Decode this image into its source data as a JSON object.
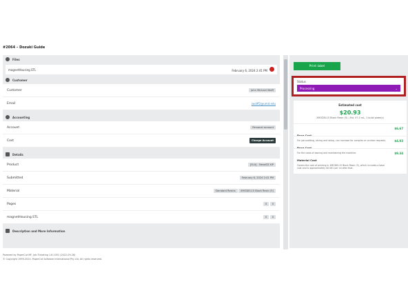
{
  "title": "#2064 – Dozuki Guide",
  "files": {
    "header": "Files",
    "name": "magnetHousing.STL",
    "date": "February 6, 2024 2:41 PM"
  },
  "customer": {
    "header": "Customer",
    "label": "Customer",
    "name": "John Michael Wolff",
    "email_label": "Email",
    "email": "jwolff2@umd.edu"
  },
  "accounting": {
    "header": "Accounting",
    "account_label": "Account",
    "account": "Personal account",
    "cost_label": "Cost",
    "charge": "Charge Account"
  },
  "details": {
    "header": "Details",
    "product_label": "Product",
    "product": "[SLA] - NexaSD XiP",
    "submitted_label": "Submitted",
    "submitted": "February 6, 2024 2:41 PM",
    "material_label": "Material",
    "material_tag1": "Standard Resins",
    "material_tag2": "XMODEL15 Black Resin (5)",
    "pages_label": "Pages",
    "pages_v1": "0",
    "pages_v2": "0",
    "file": "magnetHousing.STL",
    "file_v1": "0",
    "file_v2": "0"
  },
  "desc_header": "Description and More Information",
  "right": {
    "print": "Print label",
    "status_label": "Status",
    "status_value": "Processing",
    "est_title": "Estimated cost",
    "est_price": "$20.93",
    "est_sub": "XMODEL15 Black Resin (5) | Est. 57.5 mL, 1 build plate(s)",
    "costs": [
      {
        "name": "Base Cost",
        "desc": "For job auditing, slicing and setup, can increase for complex or unclear requests.",
        "amt": "$6.67"
      },
      {
        "name": "Base Cost",
        "desc": "For the costs of owning and maintaining the machine.",
        "amt": "$4.93"
      },
      {
        "name": "Material Cost",
        "desc": "Covers the cost of printing in XMODEL15 Black Resin (5), which includes a base cost and is approximately $0.061 per ml after that.",
        "amt": "$9.34"
      }
    ]
  },
  "footer": {
    "l1": "Powered by PaperCut MF, Job Ticketing 1.6.1051 (2022-09-26)",
    "l2": "© Copyright 1999-2024. PaperCut Software International Pty Ltd. All rights reserved."
  }
}
